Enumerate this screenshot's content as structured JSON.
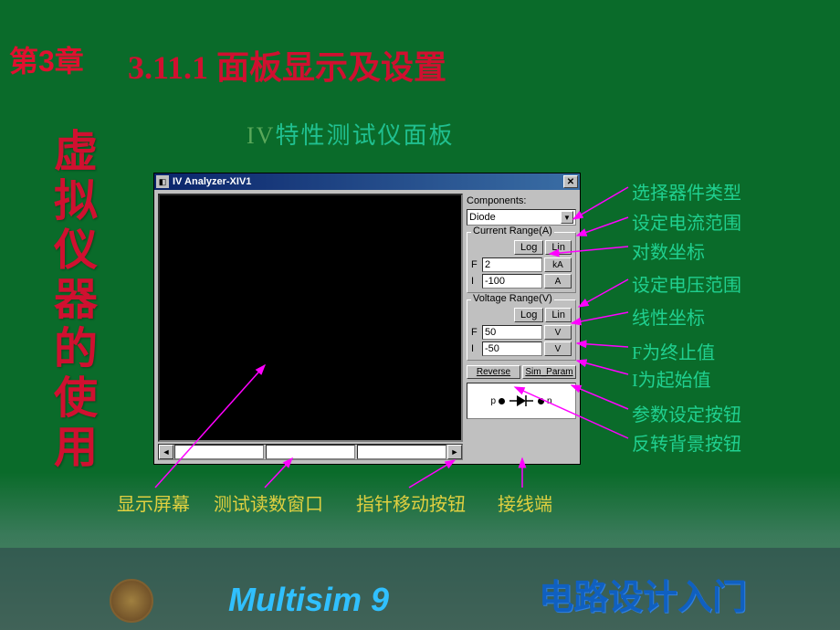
{
  "chapter": "第3章",
  "vertical": "虚拟仪器的使用",
  "section": "3.11.1 面板显示及设置",
  "panelTitle": {
    "iv": "IV",
    "rest": "特性测试仪面板"
  },
  "window": {
    "title": "IV Analyzer-XIV1",
    "componentsLabel": "Components:",
    "componentValue": "Diode",
    "currentRange": {
      "label": "Current Range(A)",
      "log": "Log",
      "lin": "Lin",
      "F": "2",
      "Funit": "kA",
      "I": "-100",
      "Iunit": "A"
    },
    "voltageRange": {
      "label": "Voltage Range(V)",
      "log": "Log",
      "lin": "Lin",
      "F": "50",
      "Funit": "V",
      "I": "-50",
      "Iunit": "V"
    },
    "reverse": "Reverse",
    "simParam": "Sim_Param",
    "symbol": {
      "p": "p",
      "n": "n"
    }
  },
  "annotationsRight": [
    "选择器件类型",
    "设定电流范围",
    "对数坐标",
    "设定电压范围",
    "线性坐标",
    "F为终止值",
    "I为起始值",
    "参数设定按钮",
    "反转背景按钮"
  ],
  "annotationsBottom": [
    "显示屏幕",
    "测试读数窗口",
    "指针移动按钮",
    "接线端"
  ],
  "footer": {
    "multisim": "Multisim 9",
    "chinese": "电路设计入门"
  }
}
